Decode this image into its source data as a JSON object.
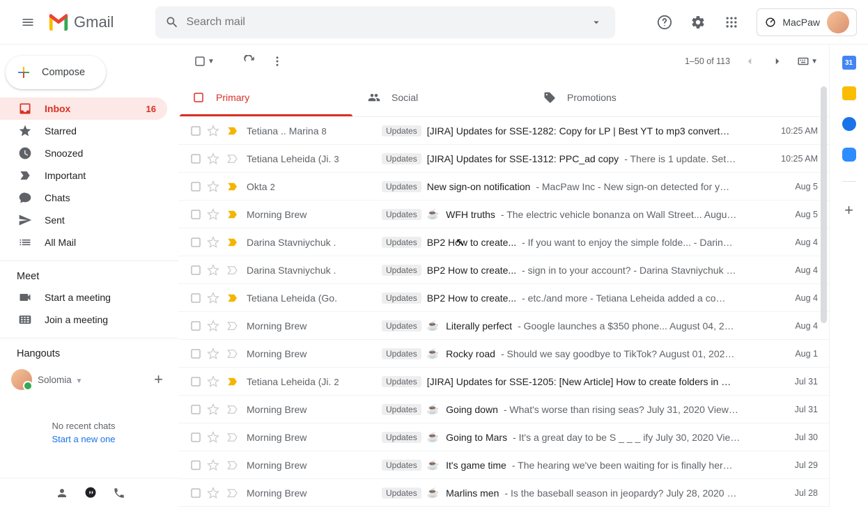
{
  "header": {
    "app_name": "Gmail",
    "search_placeholder": "Search mail",
    "workspace": "MacPaw"
  },
  "compose_label": "Compose",
  "nav": {
    "inbox": "Inbox",
    "inbox_count": "16",
    "starred": "Starred",
    "snoozed": "Snoozed",
    "important": "Important",
    "chats": "Chats",
    "sent": "Sent",
    "allmail": "All Mail"
  },
  "meet": {
    "title": "Meet",
    "start": "Start a meeting",
    "join": "Join a meeting"
  },
  "hangouts": {
    "title": "Hangouts",
    "user": "Solomia",
    "empty_line1": "No recent chats",
    "empty_line2": "Start a new one"
  },
  "toolbar": {
    "range": "1–50 of 113"
  },
  "tabs": {
    "primary": "Primary",
    "social": "Social",
    "promotions": "Promotions"
  },
  "label_updates": "Updates",
  "rows": [
    {
      "sender": "Tetiana .. Marina",
      "count": "8",
      "imp": true,
      "emoji": "",
      "subject": "[JIRA] Updates for SSE-1282: Copy for LP | Best YT to mp3 convert…",
      "snippet": "",
      "date": "10:25 AM"
    },
    {
      "sender": "Tetiana Leheida (Ji.",
      "count": "3",
      "imp": false,
      "emoji": "",
      "subject": "[JIRA] Updates for SSE-1312: PPC_ad copy",
      "snippet": " - There is 1 update. Set…",
      "date": "10:25 AM"
    },
    {
      "sender": "Okta",
      "count": "2",
      "imp": true,
      "emoji": "",
      "subject": "New sign-on notification",
      "snippet": " - MacPaw Inc - New sign-on detected for y…",
      "date": "Aug 5"
    },
    {
      "sender": "Morning Brew",
      "count": "",
      "imp": true,
      "emoji": "☕",
      "subject": "WFH truths",
      "snippet": " - The electric vehicle bonanza on Wall Street... Augu…",
      "date": "Aug 5"
    },
    {
      "sender": "Darina Stavniychuk .",
      "count": "",
      "imp": true,
      "emoji": "",
      "subject": "BP2 How to create...",
      "snippet": " - If you want to enjoy the simple folde... - Darin…",
      "date": "Aug 4"
    },
    {
      "sender": "Darina Stavniychuk .",
      "count": "",
      "imp": false,
      "emoji": "",
      "subject": "BP2 How to create...",
      "snippet": " - sign in to your account? - Darina Stavniychuk …",
      "date": "Aug 4"
    },
    {
      "sender": "Tetiana Leheida (Go.",
      "count": "",
      "imp": true,
      "emoji": "",
      "subject": "BP2 How to create...",
      "snippet": " - etc./and more - Tetiana Leheida added a co…",
      "date": "Aug 4"
    },
    {
      "sender": "Morning Brew",
      "count": "",
      "imp": false,
      "emoji": "☕",
      "subject": "Literally perfect",
      "snippet": " - Google launches a $350 phone... August 04, 2…",
      "date": "Aug 4"
    },
    {
      "sender": "Morning Brew",
      "count": "",
      "imp": false,
      "emoji": "☕",
      "subject": "Rocky road",
      "snippet": " - Should we say goodbye to TikTok? August 01, 202…",
      "date": "Aug 1"
    },
    {
      "sender": "Tetiana Leheida (Ji.",
      "count": "2",
      "imp": true,
      "emoji": "",
      "subject": "[JIRA] Updates for SSE-1205: [New Article] How to create folders in …",
      "snippet": "",
      "date": "Jul 31"
    },
    {
      "sender": "Morning Brew",
      "count": "",
      "imp": false,
      "emoji": "☕",
      "subject": "Going down",
      "snippet": " - What's worse than rising seas? July 31, 2020 View…",
      "date": "Jul 31"
    },
    {
      "sender": "Morning Brew",
      "count": "",
      "imp": false,
      "emoji": "☕",
      "subject": "Going to Mars",
      "snippet": " - It's a great day to be S _ _ _ ify July 30, 2020 Vie…",
      "date": "Jul 30"
    },
    {
      "sender": "Morning Brew",
      "count": "",
      "imp": false,
      "emoji": "☕",
      "subject": "It's game time",
      "snippet": " - The hearing we've been waiting for is finally her…",
      "date": "Jul 29"
    },
    {
      "sender": "Morning Brew",
      "count": "",
      "imp": false,
      "emoji": "☕",
      "subject": "Marlins men",
      "snippet": " - Is the baseball season in jeopardy? July 28, 2020 …",
      "date": "Jul 28"
    }
  ]
}
